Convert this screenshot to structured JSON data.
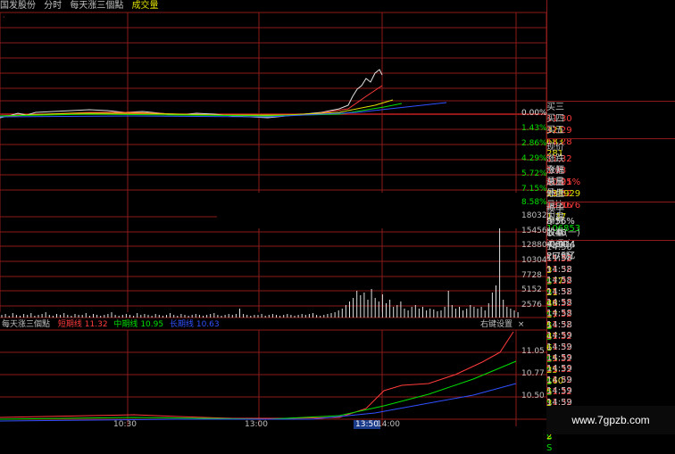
{
  "header": {
    "stock_name": "国发股份",
    "mode": "分时",
    "indicator": "每天涨三個點",
    "volume_label": "成交量"
  },
  "price_axis": [
    "0.00%",
    "1.43%",
    "2.86%",
    "4.29%",
    "5.72%",
    "7.15%",
    "8.58%"
  ],
  "volume_axis": [
    "18032",
    "15456",
    "12880",
    "10304",
    "7728",
    "5152",
    "2576"
  ],
  "indicator_bar": {
    "name": "每天涨三個點",
    "s1_label": "短期线",
    "s1_value": "11.32",
    "s2_label": "中期线",
    "s2_value": "10.95",
    "s3_label": "长期线",
    "s3_value": "10.63",
    "settings": "右键设置",
    "close": "×"
  },
  "indicator_axis": [
    "11.05",
    "10.77",
    "10.50"
  ],
  "time_axis": [
    "10:30",
    "13:00",
    "13:50",
    "14:00"
  ],
  "colors": {
    "red": "#ff3b3b",
    "green": "#00e000",
    "blue": "#3050ff",
    "yellow": "#e0e000",
    "grid": "#8b1a1a",
    "white": "#e0e0e0",
    "magenta": "#ff00ff",
    "cyan": "#00c0c0"
  },
  "quote": {
    "asks": [
      {
        "label": "买三",
        "price": "11.30",
        "vol": "321"
      },
      {
        "label": "买四",
        "price": "11.29",
        "vol": "683"
      },
      {
        "label": "买五",
        "price": "11.28",
        "vol": "281"
      }
    ],
    "stats": [
      {
        "l1": "现价",
        "v1": "11.32",
        "l2": "今开",
        "v2": "10.25"
      },
      {
        "l1": "涨跌",
        "v1": "1.03",
        "l2": "最高",
        "v2": "11.32"
      },
      {
        "l1": "涨幅",
        "v1": "10.01%",
        "l2": "最低",
        "v2": "10.16"
      },
      {
        "l1": "总量",
        "v1": "238929",
        "l2": "量比",
        "v2": "1.37"
      },
      {
        "l1": "外盘",
        "v1": "132076",
        "l2": "内盘",
        "v2": "106853"
      }
    ],
    "stats2": [
      {
        "l1": "换手",
        "v1": "8.56%",
        "l2": "股本",
        "v2": "4.64亿"
      },
      {
        "l1": "净资",
        "v1": "1.46",
        "l2": "流通",
        "v2": "2.79亿"
      },
      {
        "l1": "收益(一)",
        "v1": "-0.014",
        "l2": "PE(动)",
        "v2": "-"
      }
    ]
  },
  "ticks": [
    {
      "t": "14:58",
      "p": "11.32",
      "v": "3",
      "s": "S"
    },
    {
      "t": "14:58",
      "p": "11.32",
      "v": "177",
      "s": "S"
    },
    {
      "t": "14:58",
      "p": "11.32",
      "v": "21",
      "s": "S"
    },
    {
      "t": "14:58",
      "p": "11.32",
      "v": "48",
      "s": "S"
    },
    {
      "t": "14:58",
      "p": "11.32",
      "v": "17",
      "s": "S"
    },
    {
      "t": "14:58",
      "p": "11.32",
      "v": "5",
      "s": "S"
    },
    {
      "t": "14:58",
      "p": "11.32",
      "v": "47",
      "s": "S"
    },
    {
      "t": "14:58",
      "p": "11.32",
      "v": "6",
      "s": "S"
    },
    {
      "t": "14:59",
      "p": "11.32",
      "v": "15",
      "s": "S"
    },
    {
      "t": "14:59",
      "p": "11.32",
      "v": "25",
      "s": "S"
    },
    {
      "t": "14:59",
      "p": "11.32",
      "v": "160",
      "s": "S"
    },
    {
      "t": "14:59",
      "p": "11.32",
      "v": "5",
      "s": "S"
    },
    {
      "t": "14:59",
      "p": "11.32",
      "v": "3",
      "s": "S"
    },
    {
      "t": "14:59",
      "p": "11.32",
      "v": "1075",
      "s": "S"
    },
    {
      "t": "14:59",
      "p": "11.32",
      "v": "54",
      "s": "S"
    },
    {
      "t": "14:59",
      "p": "11.32",
      "v": "2",
      "s": "S"
    }
  ],
  "watermark": "www.7gpzb.com"
}
